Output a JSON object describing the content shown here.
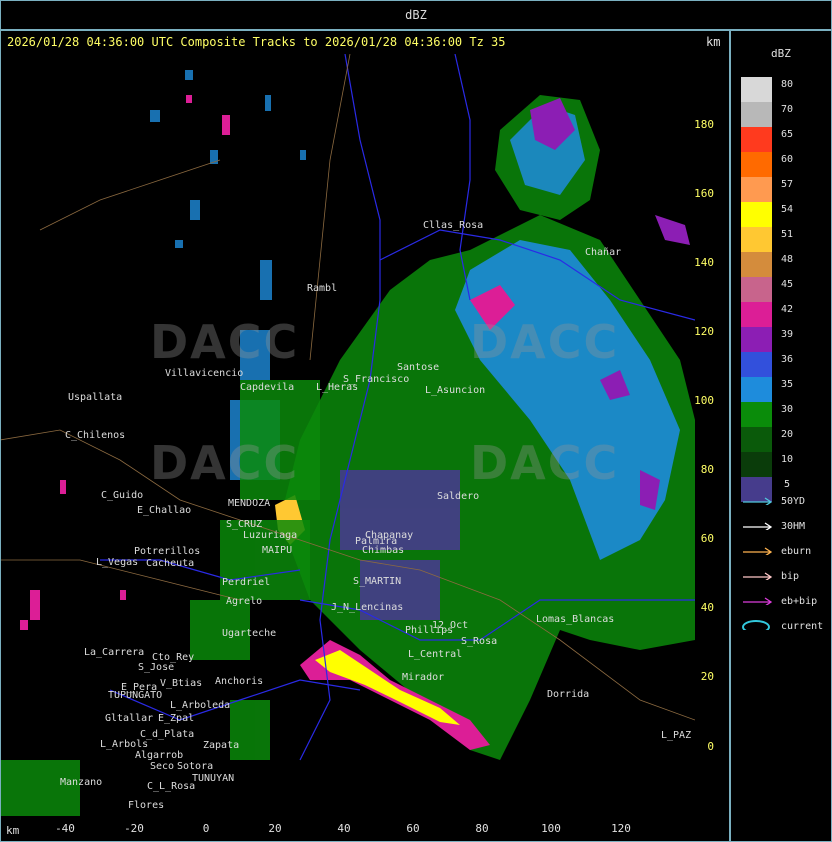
{
  "window_title": "dBZ",
  "map_title": "2026/01/28 04:36:00 UTC Composite Tracks to 2026/01/28 04:36:00 Tz 35",
  "km_label_top": "km",
  "km_label_bottom": "km",
  "y_ticks": [
    "180",
    "160",
    "140",
    "120",
    "100",
    "80",
    "60",
    "40",
    "20",
    "0"
  ],
  "x_ticks": [
    "-40",
    "-20",
    "0",
    "20",
    "40",
    "60",
    "80",
    "100",
    "120"
  ],
  "watermarks": [
    "DACC",
    "DACC",
    "DACC",
    "DACC"
  ],
  "places": [
    "Uspallata",
    "C_Chilenos",
    "Villavicencio",
    "Capdevila",
    "L_Heras",
    "S_Francisco",
    "Santose",
    "L_Asuncion",
    "Rambl",
    "Cllas_Rosa",
    "Chañar",
    "C_Guido",
    "E_Challao",
    "MENDOZA",
    "S_CRUZ",
    "Luzuriaga",
    "MAIPU",
    "Cacheuta",
    "Potrerillos",
    "L_Vegas",
    "Perdriel",
    "Agrelo",
    "Ugarteche",
    "S_MARTIN",
    "Palmira",
    "Chimbas",
    "Chapanay",
    "J_N_Lencinas",
    "12_Oct",
    "L_Central",
    "Mirador",
    "S_Rosa",
    "Lomas_Blancas",
    "Dorrida",
    "La_Carrera",
    "Cto_Rey",
    "S_Jose",
    "V_Btias",
    "E_Pera",
    "TUPUNGATO",
    "Anchoris",
    "L_Arboleda",
    "Gltallar",
    "E_Zpal",
    "L_Arbols",
    "C_d_Plata",
    "Zapata",
    "Algarrob",
    "Seco",
    "Sotora",
    "TUNUYAN",
    "C_L_Rosa",
    "Manzano",
    "Flores",
    "L_PAZ",
    "Phillips",
    "Saldero"
  ],
  "legend": {
    "title": "dBZ",
    "levels": [
      {
        "label": "80",
        "color": "#d8d8d8"
      },
      {
        "label": "70",
        "color": "#b8b8b8"
      },
      {
        "label": "65",
        "color": "#ff3a1e"
      },
      {
        "label": "60",
        "color": "#ff6a00"
      },
      {
        "label": "57",
        "color": "#ff9a50"
      },
      {
        "label": "54",
        "color": "#ffff00"
      },
      {
        "label": "51",
        "color": "#ffc832"
      },
      {
        "label": "48",
        "color": "#d48c3c"
      },
      {
        "label": "45",
        "color": "#c8648c"
      },
      {
        "label": "42",
        "color": "#dc1e96"
      },
      {
        "label": "39",
        "color": "#8c1eb4"
      },
      {
        "label": "36",
        "color": "#3250dc"
      },
      {
        "label": "35",
        "color": "#1e8cdc"
      },
      {
        "label": "30",
        "color": "#0a8c0a"
      },
      {
        "label": "20",
        "color": "#0a5a0a"
      },
      {
        "label": "10",
        "color": "#0a3c0a"
      },
      {
        "label": "5",
        "color": "#463c8c"
      }
    ],
    "tracks": [
      {
        "label": "50YD",
        "color": "#50c8dc"
      },
      {
        "label": "30HM",
        "color": "#ffffff"
      },
      {
        "label": "eburn",
        "color": "#ffb450"
      },
      {
        "label": "bip",
        "color": "#ffc8c8"
      },
      {
        "label": "eb+bip",
        "color": "#dc3cdc"
      },
      {
        "label": "current",
        "color": "#32c8dc",
        "icon": "ellipse"
      }
    ]
  }
}
